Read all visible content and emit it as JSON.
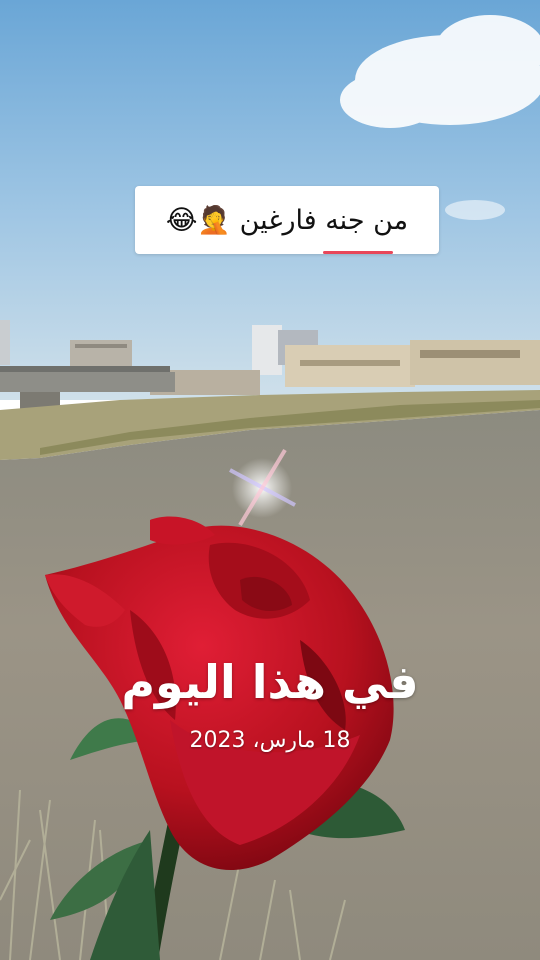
{
  "caption": {
    "text": "من جنه فارغين 🤦😂"
  },
  "memory": {
    "title": "في هذا اليوم",
    "date": "18 مارس، 2023"
  }
}
